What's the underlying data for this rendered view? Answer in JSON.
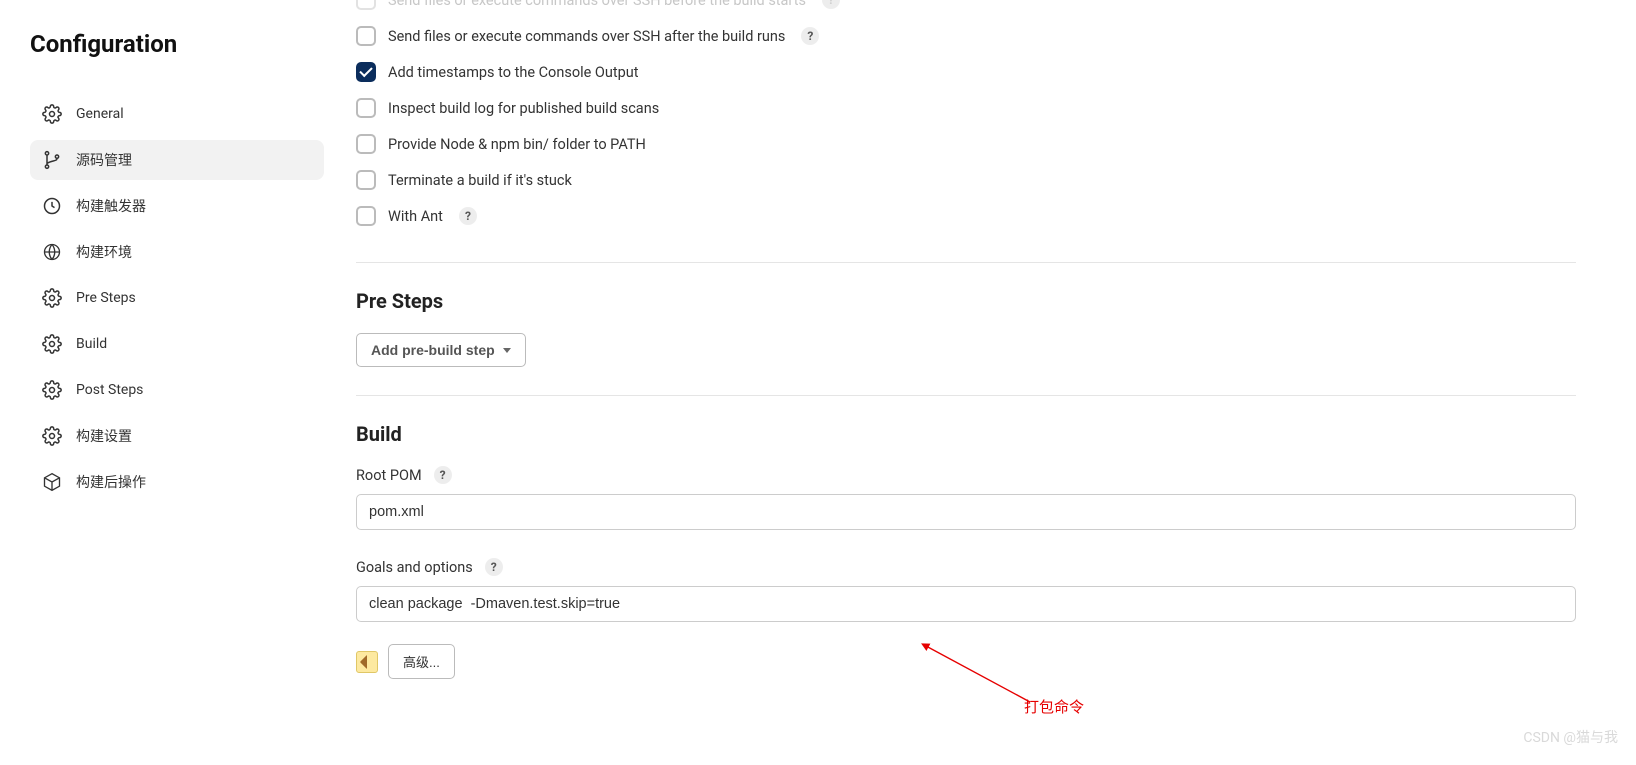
{
  "sidebar": {
    "title": "Configuration",
    "items": [
      {
        "label": "General",
        "icon": "gear"
      },
      {
        "label": "源码管理",
        "icon": "branch",
        "active": true
      },
      {
        "label": "构建触发器",
        "icon": "clock"
      },
      {
        "label": "构建环境",
        "icon": "globe"
      },
      {
        "label": "Pre Steps",
        "icon": "gear"
      },
      {
        "label": "Build",
        "icon": "gear"
      },
      {
        "label": "Post Steps",
        "icon": "gear"
      },
      {
        "label": "构建设置",
        "icon": "gear"
      },
      {
        "label": "构建后操作",
        "icon": "cube"
      }
    ]
  },
  "buildEnv": {
    "checks": [
      {
        "label": "Send files or execute commands over SSH before the build starts",
        "checked": false,
        "help": true,
        "cutoff": true
      },
      {
        "label": "Send files or execute commands over SSH after the build runs",
        "checked": false,
        "help": true
      },
      {
        "label": "Add timestamps to the Console Output",
        "checked": true,
        "help": false
      },
      {
        "label": "Inspect build log for published build scans",
        "checked": false,
        "help": false
      },
      {
        "label": "Provide Node & npm bin/ folder to PATH",
        "checked": false,
        "help": false
      },
      {
        "label": "Terminate a build if it's stuck",
        "checked": false,
        "help": false
      },
      {
        "label": "With Ant",
        "checked": false,
        "help": true
      }
    ]
  },
  "preSteps": {
    "title": "Pre Steps",
    "addBtn": "Add pre-build step"
  },
  "build": {
    "title": "Build",
    "rootPomLabel": "Root POM",
    "rootPomValue": "pom.xml",
    "goalsLabel": "Goals and options",
    "goalsValue": "clean package  -Dmaven.test.skip=true",
    "advancedBtn": "高级..."
  },
  "annotation": {
    "text": "打包命令"
  },
  "watermark": "CSDN @猫与我",
  "helpGlyph": "?"
}
